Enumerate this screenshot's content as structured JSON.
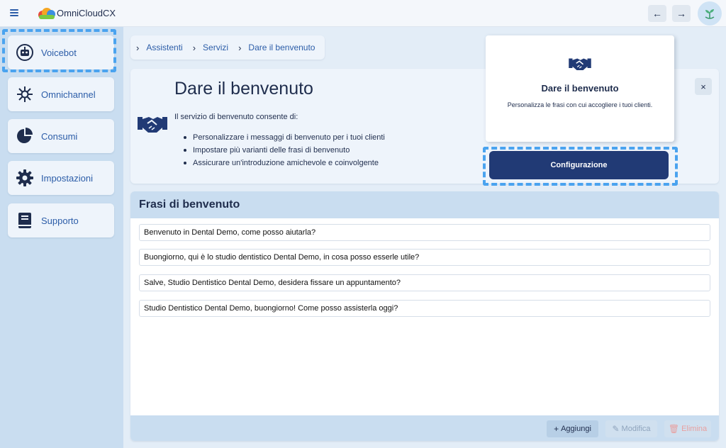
{
  "app": {
    "title": "OmniCloudCX"
  },
  "topbar": {
    "back_icon": "←",
    "forward_icon": "→"
  },
  "sidebar": {
    "items": [
      {
        "label": "Voicebot",
        "icon": "robot-icon"
      },
      {
        "label": "Omnichannel",
        "icon": "network-icon"
      },
      {
        "label": "Consumi",
        "icon": "pie-chart-icon"
      },
      {
        "label": "Impostazioni",
        "icon": "gear-icon"
      },
      {
        "label": "Supporto",
        "icon": "book-icon"
      }
    ]
  },
  "breadcrumb": {
    "items": [
      "Assistenti",
      "Servizi",
      "Dare il benvenuto"
    ],
    "separator": "›"
  },
  "hero": {
    "title": "Dare il benvenuto",
    "description": "Il servizio di benvenuto consente di:",
    "bullets": [
      "Personalizzare i messaggi di benvenuto per i tuoi clienti",
      "Impostare più varianti delle frasi di benvenuto",
      "Assicurare un'introduzione amichevole e coinvolgente"
    ],
    "close_label": "×",
    "icon": "handshake-icon"
  },
  "popover": {
    "title": "Dare il benvenuto",
    "subtitle": "Personalizza le frasi con cui accogliere i tuoi clienti.",
    "button_label": "Configurazione"
  },
  "phrases": {
    "title": "Frasi di benvenuto",
    "items": [
      "Benvenuto in Dental Demo, come posso aiutarla?",
      "Buongiorno, qui è lo studio dentistico Dental Demo, in cosa posso esserle utile?",
      "Salve, Studio Dentistico Dental Demo, desidera fissare un appuntamento?",
      "Studio Dentistico Dental Demo, buongiorno! Come posso assisterla oggi?"
    ],
    "add_label": "Aggiungi",
    "edit_label": "Modifica",
    "delete_label": "Elimina"
  },
  "colors": {
    "primary": "#213a75",
    "accent": "#2c5da8",
    "highlight": "#4aa3ef",
    "sidebar_bg": "#c9ddf0",
    "delete": "#e57373"
  }
}
